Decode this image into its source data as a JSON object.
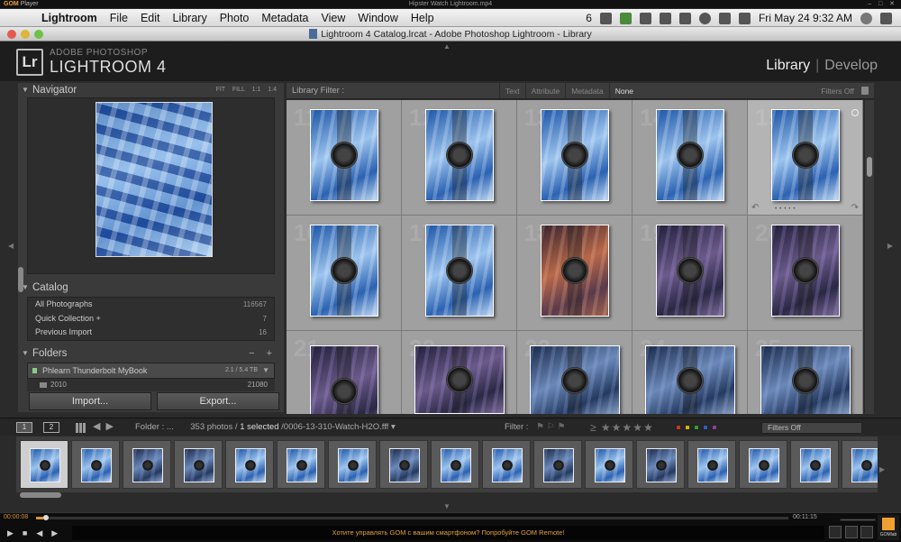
{
  "gom": {
    "logo": "GOM",
    "logo_suffix": "Player",
    "file_name": "Hipster Watch Lightroom.mp4",
    "time_elapsed": "00:00:08",
    "time_total": "00:11:15",
    "progress": 0.01,
    "message": "Хотите управлять GOM с вашим смартфоном? Попробуйте GOM Remote!",
    "lab_label": "GOMlab"
  },
  "menubar": {
    "app": "Lightroom",
    "items": [
      "File",
      "Edit",
      "Library",
      "Photo",
      "Metadata",
      "View",
      "Window",
      "Help"
    ],
    "status_num": "6",
    "clock": "Fri May 24  9:32 AM"
  },
  "window": {
    "title": "Lightroom 4 Catalog.lrcat - Adobe Photoshop Lightroom - Library"
  },
  "identity": {
    "logo": "Lr",
    "sub": "ADOBE PHOTOSHOP",
    "name": "LIGHTROOM 4",
    "module_active": "Library",
    "module_other": "Develop",
    "separator": "|"
  },
  "navigator": {
    "title": "Navigator",
    "zooms": "FIT  FILL  1:1  1:4"
  },
  "catalog": {
    "title": "Catalog",
    "rows": [
      {
        "label": "All Photographs",
        "count": "116567"
      },
      {
        "label": "Quick Collection  +",
        "count": "7"
      },
      {
        "label": "Previous Import",
        "count": "16"
      }
    ]
  },
  "folders": {
    "title": "Folders",
    "controls": "− +",
    "volume": {
      "label": "Phlearn Thunderbolt MyBook",
      "size": "2.1 / 5.4 TB"
    },
    "rows": [
      {
        "label": "2010",
        "count": "21080"
      }
    ]
  },
  "buttons": {
    "import": "Import...",
    "export": "Export..."
  },
  "filter_bar": {
    "label": "Library Filter :",
    "options": [
      "Text",
      "Attribute",
      "Metadata",
      "None"
    ],
    "active": "None",
    "preset": "Filters Off"
  },
  "grid": {
    "cell_numbers": [
      "11",
      "12",
      "13",
      "14",
      "15",
      "16",
      "17",
      "18",
      "19",
      "20",
      "21",
      "22",
      "23",
      "24",
      "25"
    ],
    "tones": [
      "blue",
      "blue",
      "blue",
      "blue",
      "blue",
      "blue",
      "blue",
      "orange",
      "purple",
      "purple",
      "purple",
      "purple",
      "darkblue",
      "darkblue",
      "darkblue"
    ]
  },
  "filmstrip_header": {
    "screen1": "1",
    "screen2": "2",
    "folder_label": "Folder : ...",
    "count": "353 photos /",
    "selected": "1 selected",
    "path": "/0006-13-310-Watch-H2O.fff ▾",
    "filter_label": "Filter :",
    "stars": "≥ ★★★★★",
    "preset": "Filters Off",
    "label_colors": [
      "#c0392b",
      "#d4b000",
      "#2e9e3e",
      "#2d5fc0",
      "#8a3fa0"
    ]
  },
  "filmstrip": {
    "count": 17,
    "selected_index": 0
  }
}
